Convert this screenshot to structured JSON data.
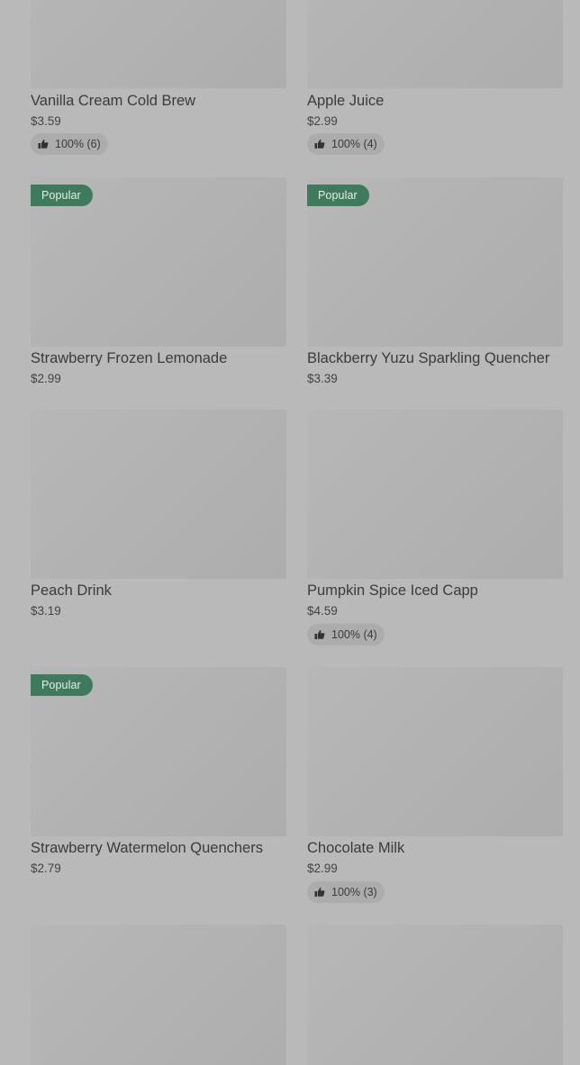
{
  "items": [
    {
      "name": "Vanilla Cream Cold Brew",
      "price": "$3.59",
      "badge": "",
      "rating": "100% (6)"
    },
    {
      "name": "Apple Juice",
      "price": "$2.99",
      "badge": "",
      "rating": "100% (4)"
    },
    {
      "name": "Strawberry Frozen Lemonade",
      "price": "$2.99",
      "badge": "Popular",
      "rating": ""
    },
    {
      "name": "Blackberry Yuzu Sparkling Quencher",
      "price": "$3.39",
      "badge": "Popular",
      "rating": ""
    },
    {
      "name": "Peach Drink",
      "price": "$3.19",
      "badge": "",
      "rating": ""
    },
    {
      "name": "Pumpkin Spice Iced Capp",
      "price": "$4.59",
      "badge": "",
      "rating": "100% (4)"
    },
    {
      "name": "Strawberry Watermelon Quenchers",
      "price": "$2.79",
      "badge": "Popular",
      "rating": ""
    },
    {
      "name": "Chocolate Milk",
      "price": "$2.99",
      "badge": "",
      "rating": "100% (3)"
    },
    {
      "name": "",
      "price": "",
      "badge": "",
      "rating": ""
    },
    {
      "name": "",
      "price": "",
      "badge": "",
      "rating": ""
    }
  ],
  "icons": {
    "rating": "thumbs-up-icon"
  },
  "colors": {
    "overlay_background": "#b9b9b9",
    "badge_background": "#3e7a5c",
    "rating_pill_background": "#acacac"
  }
}
